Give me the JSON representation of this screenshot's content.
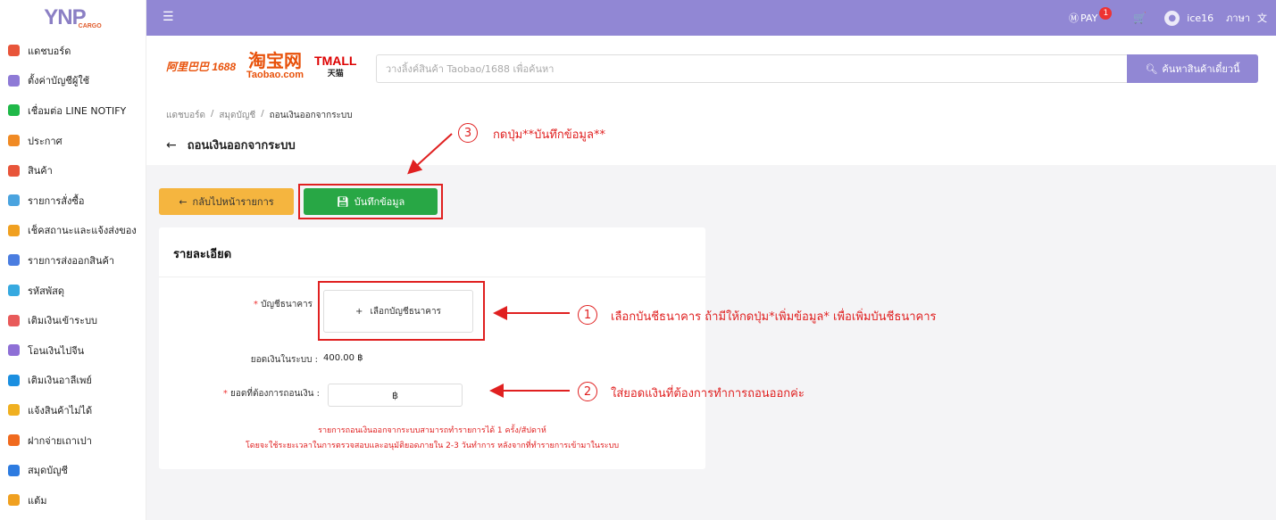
{
  "logo": {
    "main": "YNP",
    "sub": "CARGO"
  },
  "sidebar": {
    "items": [
      {
        "label": "แดชบอร์ด",
        "icon": "dashboard-icon",
        "color": "#e8553a"
      },
      {
        "label": "ตั้งค่าบัญชีผู้ใช้",
        "icon": "user-settings-icon",
        "color": "#8e7ad6"
      },
      {
        "label": "เชื่อมต่อ LINE NOTIFY",
        "icon": "line-icon",
        "color": "#1fb848"
      },
      {
        "label": "ประกาศ",
        "icon": "megaphone-icon",
        "color": "#f08a24"
      },
      {
        "label": "สินค้า",
        "icon": "product-icon",
        "color": "#e8553a"
      },
      {
        "label": "รายการสั่งซื้อ",
        "icon": "cart-icon",
        "color": "#4aa3df"
      },
      {
        "label": "เช็คสถานะและแจ้งส่งของ",
        "icon": "truck-icon",
        "color": "#f0a020"
      },
      {
        "label": "รายการส่งออกสินค้า",
        "icon": "export-icon",
        "color": "#4a7de0"
      },
      {
        "label": "รหัสพัสดุ",
        "icon": "package-icon",
        "color": "#36a9e0"
      },
      {
        "label": "เติมเงินเข้าระบบ",
        "icon": "piggy-bank-icon",
        "color": "#e85a5a"
      },
      {
        "label": "โอนเงินไปจีน",
        "icon": "yuan-icon",
        "color": "#8e6fd6"
      },
      {
        "label": "เติมเงินอาลีเพย์",
        "icon": "alipay-icon",
        "color": "#1b8fe0"
      },
      {
        "label": "แจ้งสินค้าไม่ได้",
        "icon": "report-icon",
        "color": "#f0b020"
      },
      {
        "label": "ฝากจ่ายเถาเปา",
        "icon": "taobao-pay-icon",
        "color": "#f06a1e"
      },
      {
        "label": "สมุดบัญชี",
        "icon": "ledger-icon",
        "color": "#2d7be0"
      },
      {
        "label": "แต้ม",
        "icon": "points-icon",
        "color": "#f0a020"
      }
    ]
  },
  "topbar": {
    "pay": "PAY",
    "pay_badge": "1",
    "username": "ice16",
    "language": "ภาษา"
  },
  "brands": {
    "b1688": "阿里巴巴 1688",
    "taobao_cn": "淘宝网",
    "taobao_en": "Taobao.com",
    "tmall": "TMALL",
    "tmall_sub": "天猫"
  },
  "search": {
    "placeholder": "วางลิ้งค์สินค้า Taobao/1688 เพื่อค้นหา",
    "button": "ค้นหาสินค้าเดี๋ยวนี้"
  },
  "breadcrumb": [
    "แดชบอร์ด",
    "/",
    "สมุดบัญชี",
    "/",
    "ถอนเงินออกจากระบบ"
  ],
  "page_title": "ถอนเงินออกจากระบบ",
  "buttons": {
    "back": "กลับไปหน้ารายการ",
    "save": "บันทึกข้อมูล"
  },
  "card": {
    "title": "รายละเอียด",
    "bank_label": "บัญชีธนาคาร",
    "bank_button": "เลือกบัญชีธนาคาร",
    "balance_label": "ยอดเงินในระบบ :",
    "balance_value": "400.00 ฿",
    "amount_label": "ยอดที่ต้องการถอนเงิน :",
    "amount_unit": "฿",
    "notice1": "รายการถอนเงินออกจากระบบสามารถทำรายการได้ 1 ครั้ง/สัปดาห์",
    "notice2": "โดยจะใช้ระยะเวลาในการตรวจสอบและอนุมัติยอดภายใน 2-3 วันทำการ หลังจากที่ทำรายการเข้ามาในระบบ"
  },
  "annotations": {
    "a1": {
      "num": "1",
      "text": "เลือกบันชีธนาคาร ถ้ามีให้กดปุ่ม*เพิ่มข้อมูล* เพื่อเพิ่มบันชีธนาคาร"
    },
    "a2": {
      "num": "2",
      "text": "ใส่ยอดแงินที่ต้องการทำการถอนออกค่ะ"
    },
    "a3": {
      "num": "3",
      "text": "กดปุ่ม**บันทึกข้อมูล**"
    }
  },
  "colors": {
    "accent": "#9187d4",
    "save": "#28a745",
    "back": "#f5b53f",
    "annotation": "#e02020"
  }
}
